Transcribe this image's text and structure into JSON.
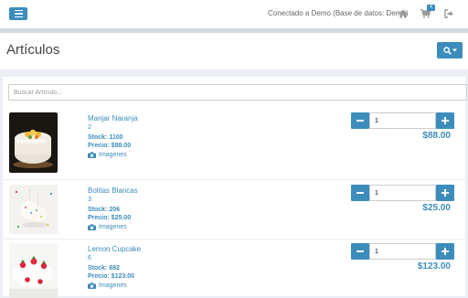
{
  "topbar": {
    "connection_text": "Conectado a Demo (Base de datos: Demo)",
    "cart_count": "4"
  },
  "header": {
    "title": "Artículos"
  },
  "search": {
    "placeholder": "Buscar Artículo..."
  },
  "colors": {
    "accent": "#3c8dbc"
  },
  "icons": [
    "menu-icon",
    "home-icon",
    "cart-icon",
    "sign-out-icon",
    "search-icon",
    "caret-down-icon",
    "camera-icon",
    "minus-icon",
    "plus-icon"
  ],
  "items": [
    {
      "name": "Manjar Naranja",
      "code": "2",
      "stock": "Stock: 1100",
      "price": "Precio: $88.00",
      "images_label": "Imagenes",
      "qty": "1",
      "total": "$88.00"
    },
    {
      "name": "Bolitas Blancas",
      "code": "3",
      "stock": "Stock: 206",
      "price": "Precio: $25.00",
      "images_label": "Imagenes",
      "qty": "1",
      "total": "$25.00"
    },
    {
      "name": "Lemon Cupcake",
      "code": "6",
      "stock": "Stock: 682",
      "price": "Precio: $123.00",
      "images_label": "Imagenes",
      "qty": "1",
      "total": "$123.00"
    }
  ]
}
